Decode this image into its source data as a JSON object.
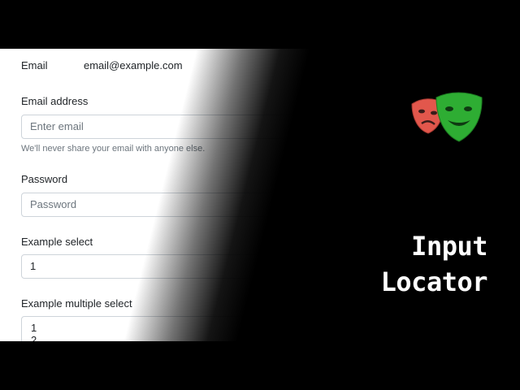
{
  "form": {
    "email_static": {
      "label": "Email",
      "value": "email@example.com"
    },
    "email_address": {
      "label": "Email address",
      "placeholder": "Enter email",
      "help": "We'll never share your email with anyone else."
    },
    "password": {
      "label": "Password",
      "placeholder": "Password"
    },
    "select": {
      "label": "Example select",
      "value": "1"
    },
    "multi_select": {
      "label": "Example multiple select",
      "options": [
        "1",
        "2"
      ]
    }
  },
  "title": {
    "line1": "Input",
    "line2": "Locator"
  },
  "logo": {
    "icon": "playwright-masks-icon",
    "colors": {
      "red_mask": "#e2574c",
      "green_mask": "#2ead33"
    }
  }
}
